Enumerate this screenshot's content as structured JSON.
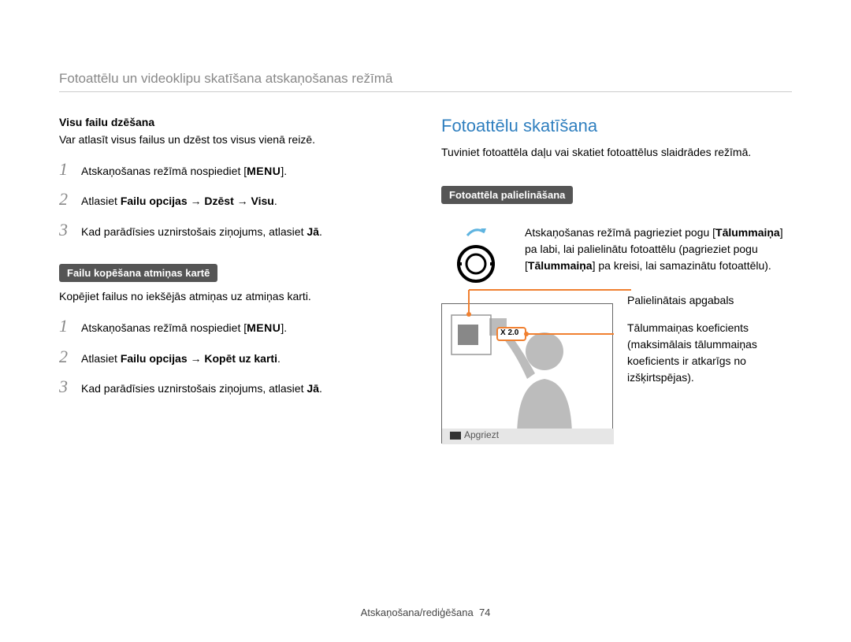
{
  "header": "Fotoattēlu un videoklipu skatīšana atskaņošanas režīmā",
  "left": {
    "sec1": {
      "heading": "Visu failu dzēšana",
      "desc": "Var atlasīt visus failus un dzēst tos visus vienā reizē.",
      "steps": {
        "s1a": "Atskaņošanas režīmā nospiediet [",
        "s1b": "MENU",
        "s1c": "].",
        "s2a": "Atlasiet ",
        "s2b": "Failu opcijas → Dzēst → Visu",
        "s2c": ".",
        "s3a": "Kad parādīsies uznirstošais ziņojums, atlasiet ",
        "s3b": "Jā",
        "s3c": "."
      }
    },
    "sec2": {
      "pill": "Failu kopēšana atmiņas kartē",
      "desc": "Kopējiet failus no iekšējās atmiņas uz atmiņas karti.",
      "steps": {
        "s1a": "Atskaņošanas režīmā nospiediet [",
        "s1b": "MENU",
        "s1c": "].",
        "s2a": "Atlasiet ",
        "s2b": "Failu opcijas → Kopēt uz karti",
        "s2c": ".",
        "s3a": "Kad parādīsies uznirstošais ziņojums, atlasiet ",
        "s3b": "Jā",
        "s3c": "."
      }
    }
  },
  "right": {
    "title": "Fotoattēlu skatīšana",
    "desc": "Tuviniet fotoattēla daļu vai skatiet fotoattēlus slaidrādes režīmā.",
    "pill": "Fotoattēla palielināšana",
    "knob_text": {
      "a": "Atskaņošanas režīmā pagrieziet pogu [",
      "b": "Tālummaiņa",
      "c": "] pa labi, lai palielinātu fotoattēlu (pagrieziet pogu [",
      "d": "Tālummaiņa",
      "e": "] pa kreisi, lai samazinātu fotoattēlu)."
    },
    "zoom_badge": "X 2.0",
    "screen_label": "Apgriezt",
    "callout1": "Palielinātais apgabals",
    "callout2": "Tālummaiņas koeficients (maksimālais tālummaiņas koeficients ir atkarīgs no izšķirtspējas).",
    "nums": {
      "n1": "1",
      "n2": "2",
      "n3": "3"
    }
  },
  "footer": {
    "label": "Atskaņošana/rediģēšana",
    "page": "74"
  }
}
